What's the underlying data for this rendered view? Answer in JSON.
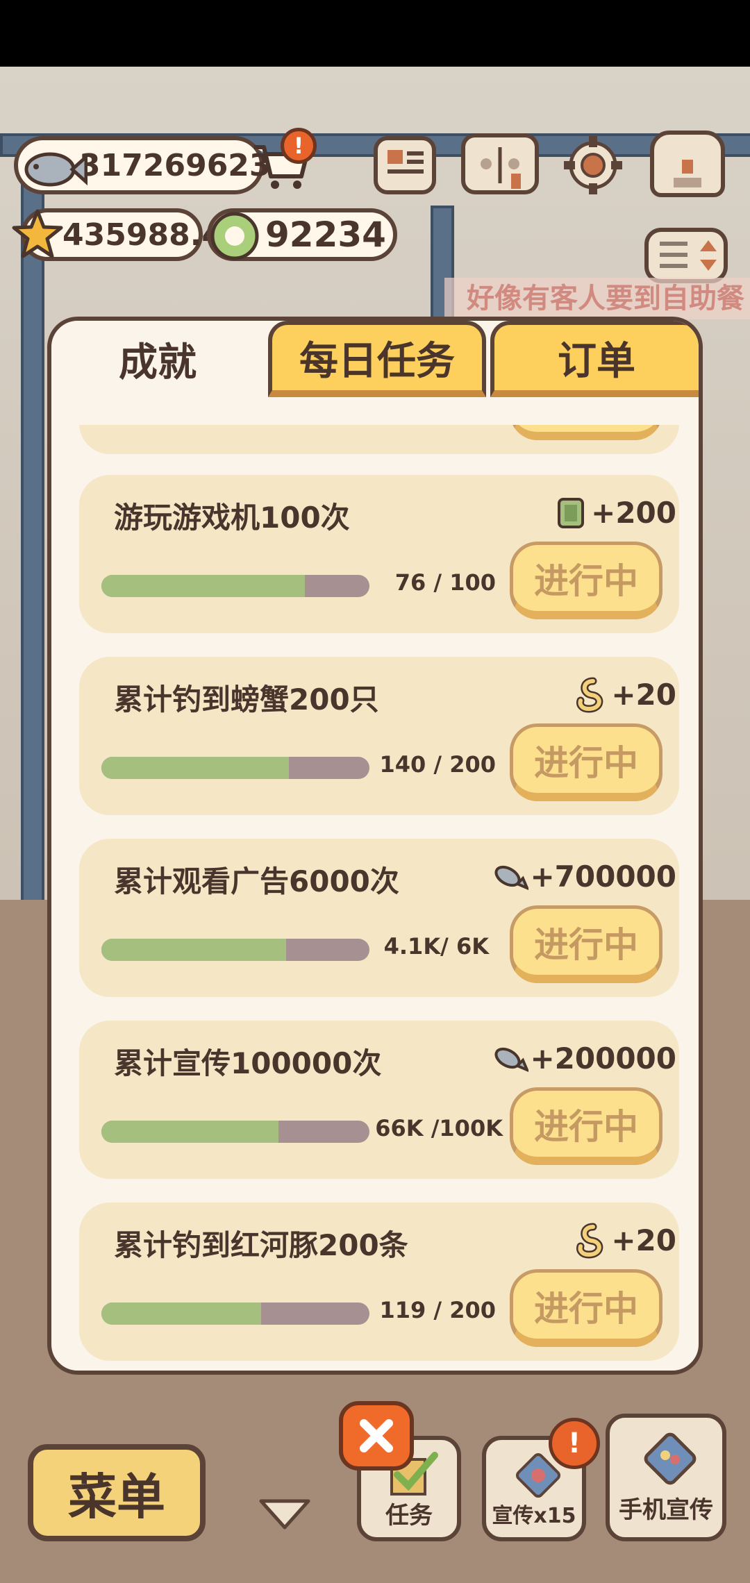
{
  "hud": {
    "fish_count": "3172696233",
    "star_count": "435988.4",
    "coin_count": "92234"
  },
  "ticker_text": "好像有客人要到自助餐",
  "tabs": [
    {
      "label": "成就",
      "active": true
    },
    {
      "label": "每日任务",
      "active": false
    },
    {
      "label": "订单",
      "active": false
    }
  ],
  "achievements": [
    {
      "title": "游玩游戏机100次",
      "reward_icon": "ticket-icon",
      "reward": "+200",
      "current": "76",
      "target": "100",
      "progress": 0.76,
      "status": "进行中"
    },
    {
      "title": "累计钓到螃蟹200只",
      "reward_icon": "golden-snake-icon",
      "reward": "+20",
      "current": "140",
      "target": "200",
      "progress": 0.7,
      "status": "进行中"
    },
    {
      "title": "累计观看广告6000次",
      "reward_icon": "fish-icon",
      "reward": "+700000",
      "current": "4.1K",
      "target": "6K",
      "progress": 0.69,
      "status": "进行中"
    },
    {
      "title": "累计宣传100000次",
      "reward_icon": "fish-icon",
      "reward": "+200000",
      "current": "66K",
      "target": "100K",
      "progress": 0.66,
      "status": "进行中"
    },
    {
      "title": "累计钓到红河豚200条",
      "reward_icon": "golden-snake-icon",
      "reward": "+20",
      "current": "119",
      "target": "200",
      "progress": 0.595,
      "status": "进行中"
    }
  ],
  "bottom": {
    "menu_label": "菜单",
    "tasks_label": "任务",
    "promo_label": "宣传x15",
    "phone_promo_label": "手机宣传",
    "badge_mark": "!"
  },
  "colors": {
    "accent_yellow": "#fdcf5c",
    "outline_brown": "#5c4338",
    "bar_green": "#a5bf7f",
    "bar_track": "#a69092",
    "close_orange": "#f06a2a"
  }
}
